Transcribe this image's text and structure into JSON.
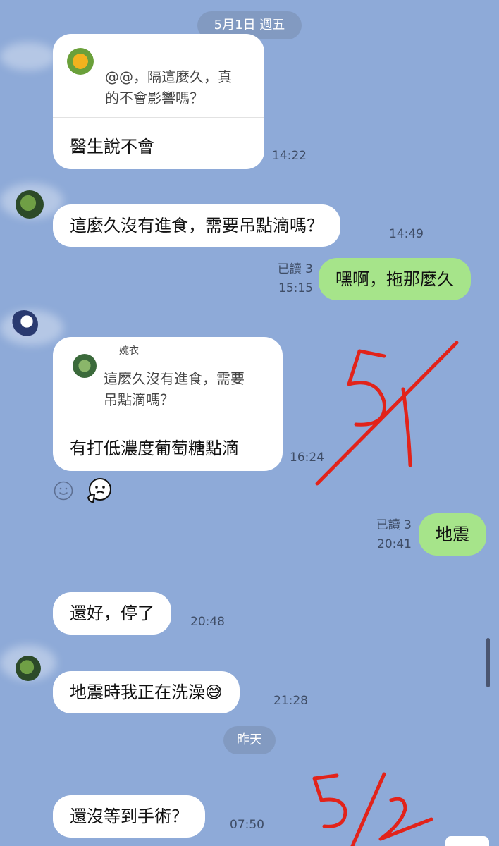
{
  "date_pills": {
    "first": "5月1日 週五",
    "yesterday": "昨天"
  },
  "messages": {
    "m1": {
      "quote_name": "",
      "quote_text_line1": "@@，隔這麼久，真",
      "quote_text_line2": "的不會影響嗎？",
      "text": "醫生說不會",
      "time": "14:22"
    },
    "m2": {
      "text": "這麼久沒有進食，需要吊點滴嗎？",
      "time": "14:49"
    },
    "m3": {
      "text": "嘿啊，拖那麼久",
      "read": "已讀 3",
      "time": "15:15"
    },
    "m4": {
      "quote_name": "婉衣",
      "quote_text_line1": "這麼久沒有進食，需要",
      "quote_text_line2": "吊點滴嗎？",
      "text": "有打低濃度葡萄糖點滴",
      "time": "16:24"
    },
    "m5": {
      "text": "地震",
      "read": "已讀 3",
      "time": "20:41"
    },
    "m6": {
      "text": "還好，停了",
      "time": "20:48"
    },
    "m7": {
      "text": "地震時我正在洗澡😅",
      "time": "21:28"
    },
    "m8": {
      "text": "還沒等到手術？",
      "time": "07:50"
    }
  },
  "annotations": {
    "first": "5/1",
    "second": "5/2"
  },
  "colors": {
    "background": "#8eaad8",
    "incoming_bubble": "#ffffff",
    "outgoing_bubble": "#a6e48a",
    "annotation_red": "#e2231a"
  }
}
